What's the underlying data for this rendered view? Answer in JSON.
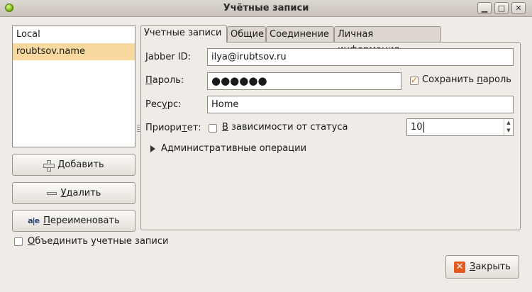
{
  "window": {
    "title": "Учётные записи"
  },
  "accounts": [
    {
      "label": "Local",
      "selected": false
    },
    {
      "label": "roubtsov.name",
      "selected": true
    }
  ],
  "buttons": {
    "add_mnemonic": "Д",
    "add_rest": "обавить",
    "remove_mnemonic": "У",
    "remove_rest": "далить",
    "rename_icon": "a|e",
    "rename_mnemonic": "П",
    "rename_rest": "ереименовать",
    "close_mnemonic": "З",
    "close_rest": "акрыть"
  },
  "merge": {
    "label_mnemonic": "О",
    "label_rest": "бъединить учетные записи",
    "checked": false
  },
  "tabs": [
    {
      "label": "Учетные записи",
      "active": true
    },
    {
      "label": "Общие",
      "active": false
    },
    {
      "label": "Соединение",
      "active": false
    },
    {
      "label": "Личная информация",
      "active": false
    }
  ],
  "form": {
    "jid_mnemonic": "J",
    "jid_rest": "abber ID:",
    "jid_value": "ilya@irubtsov.ru",
    "pwd_mnemonic": "П",
    "pwd_rest": "ароль:",
    "pwd_value": "●●●●●●",
    "save_pwd_pre": "Сохранить ",
    "save_pwd_mnemonic": "п",
    "save_pwd_post": "ароль",
    "save_pwd_checked": true,
    "res_pre": "Рес",
    "res_mnemonic": "у",
    "res_post": "рс:",
    "res_value": "Home",
    "prio_pre": "Приори",
    "prio_mnemonic": "т",
    "prio_post": "ет:",
    "prio_dep_mnemonic": "В",
    "prio_dep_rest": " зависимости от статуса",
    "prio_dep_checked": false,
    "prio_value": "10",
    "admin_label": "Административные операции"
  }
}
